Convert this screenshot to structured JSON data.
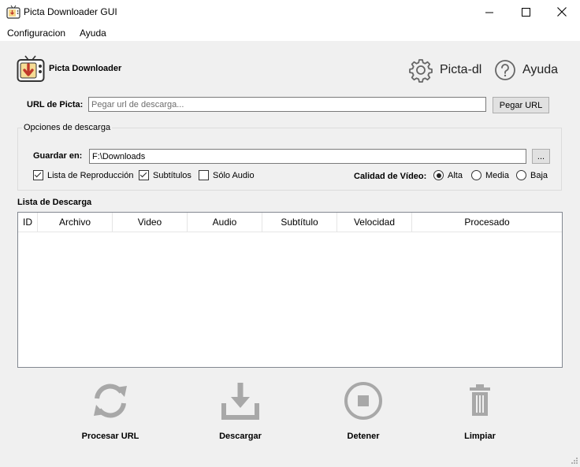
{
  "window": {
    "title": "Picta Downloader GUI",
    "controls": [
      "minimize",
      "maximize",
      "close"
    ]
  },
  "menu": {
    "items": [
      "Configuracion",
      "Ayuda"
    ]
  },
  "header": {
    "app_name": "Picta Downloader",
    "picta_dl_label": "Picta-dl",
    "help_label": "Ayuda",
    "icons": {
      "picta_dl": "gear-icon",
      "help": "question-circle-icon"
    }
  },
  "url": {
    "label": "URL de Picta:",
    "value": "",
    "placeholder": "Pegar url de descarga...",
    "paste_button": "Pegar URL"
  },
  "options": {
    "group_title": "Opciones de descarga",
    "save_label": "Guardar en:",
    "save_value": "F:\\Downloads",
    "browse_button": "...",
    "checkboxes": [
      {
        "label": "Lista de Reproducción",
        "checked": true
      },
      {
        "label": "Subtítulos",
        "checked": true
      },
      {
        "label": "Sólo Audio",
        "checked": false
      }
    ],
    "quality_label": "Calidad de Vídeo:",
    "quality_options": [
      {
        "label": "Alta",
        "selected": true
      },
      {
        "label": "Media",
        "selected": false
      },
      {
        "label": "Baja",
        "selected": false
      }
    ]
  },
  "download_list": {
    "title": "Lista de Descarga",
    "columns": [
      "ID",
      "Archivo",
      "Video",
      "Audio",
      "Subtítulo",
      "Velocidad",
      "Procesado"
    ],
    "rows": []
  },
  "actions": {
    "process": {
      "label": "Procesar URL",
      "icon": "refresh-icon"
    },
    "download": {
      "label": "Descargar",
      "icon": "download-tray-icon"
    },
    "stop": {
      "label": "Detener",
      "icon": "stop-circle-icon"
    },
    "clear": {
      "label": "Limpiar",
      "icon": "trash-icon"
    }
  },
  "colors": {
    "window_bg": "#f0f0f0",
    "icon_gray": "#a8a8a8",
    "logo_gold": "#d8a020",
    "logo_red": "#c0392b"
  }
}
